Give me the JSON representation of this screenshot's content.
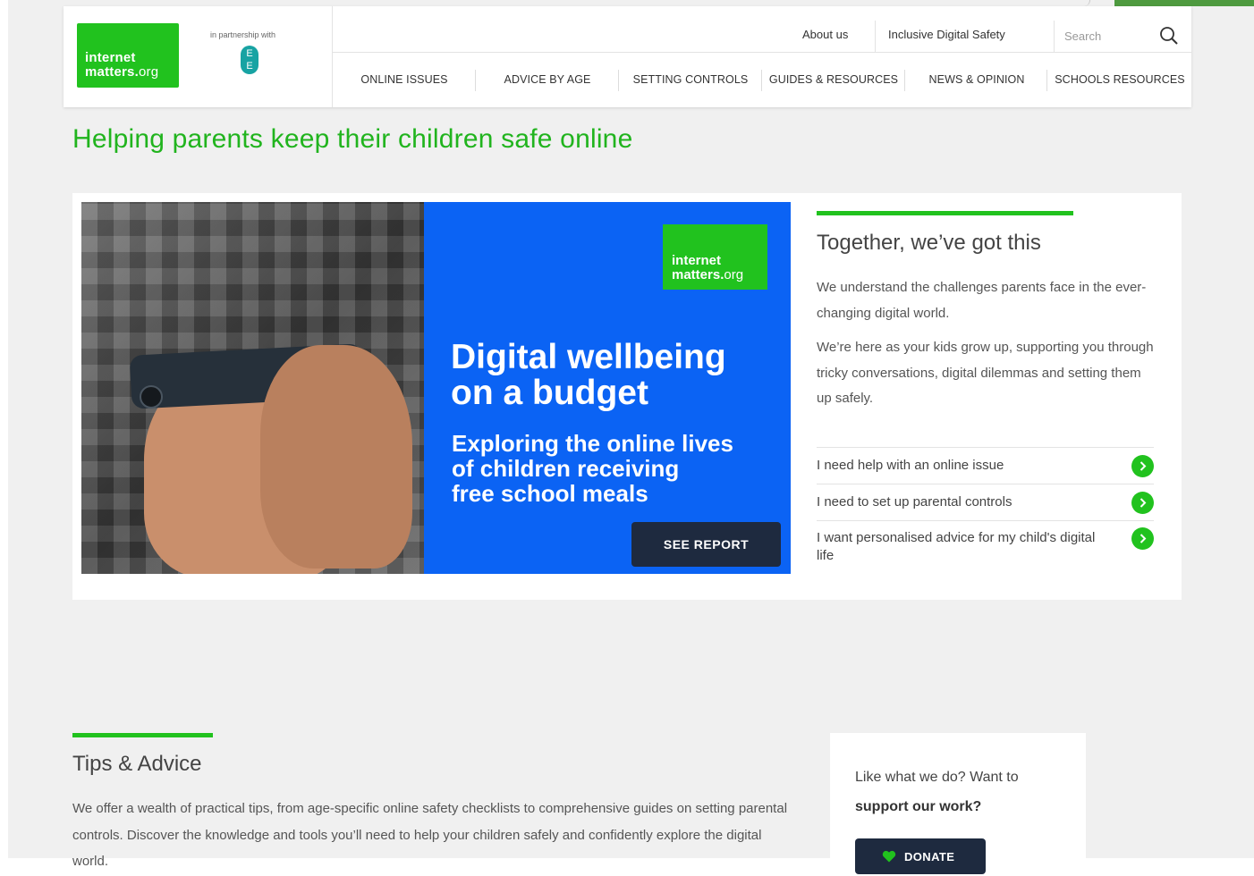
{
  "colors": {
    "brand_green": "#21c21e",
    "title_green": "#21b41e",
    "banner_blue": "#0b63f4",
    "button_navy": "#1e2a3f",
    "page_bg": "#f0f0f0"
  },
  "header": {
    "logo": {
      "line1": "internet",
      "line2": "matters.",
      "line2_suffix": "org"
    },
    "partner_text": "in partnership with",
    "partner_logo": {
      "line1": "E",
      "line2": "E"
    },
    "utility_links": [
      "About us",
      "Inclusive Digital Safety"
    ],
    "search": {
      "placeholder": "Search",
      "icon": "search-icon"
    },
    "nav": [
      "ONLINE ISSUES",
      "ADVICE BY AGE",
      "SETTING CONTROLS",
      "GUIDES & RESOURCES",
      "NEWS & OPINION",
      "SCHOOLS RESOURCES"
    ]
  },
  "page_title": "Helping parents keep their children safe online",
  "hero": {
    "banner_logo": {
      "line1": "internet",
      "line2": "matters.",
      "line2_suffix": "org"
    },
    "heading_line1": "Digital wellbeing",
    "heading_line2": "on a budget",
    "sub_line1": "Exploring the online lives",
    "sub_line2": "of children receiving",
    "sub_line3": "free school meals",
    "button_label": "SEE REPORT"
  },
  "side": {
    "heading": "Together, we’ve got this",
    "paragraph1": "We understand the challenges parents face in the ever-changing digital world.",
    "paragraph2": "We’re here as your kids grow up, supporting you through tricky conversations, digital dilemmas and setting them up safely.",
    "links": [
      {
        "label": "I need help with an online issue",
        "icon": "chevron-right-icon"
      },
      {
        "label": "I need to set up parental controls",
        "icon": "chevron-right-icon"
      },
      {
        "label": "I want personalised advice for my child's digital life",
        "icon": "chevron-right-icon"
      }
    ]
  },
  "tips": {
    "heading": "Tips & Advice",
    "text": "We offer a wealth of practical tips, from age-specific online safety checklists to comprehensive guides on setting parental controls. Discover the knowledge and tools you’ll need to help your children safely and confidently explore the digital world."
  },
  "support": {
    "line1": "Like what we do? Want to",
    "line2": "support our work?",
    "button_label": "DONATE",
    "button_icon": "heart-icon"
  }
}
